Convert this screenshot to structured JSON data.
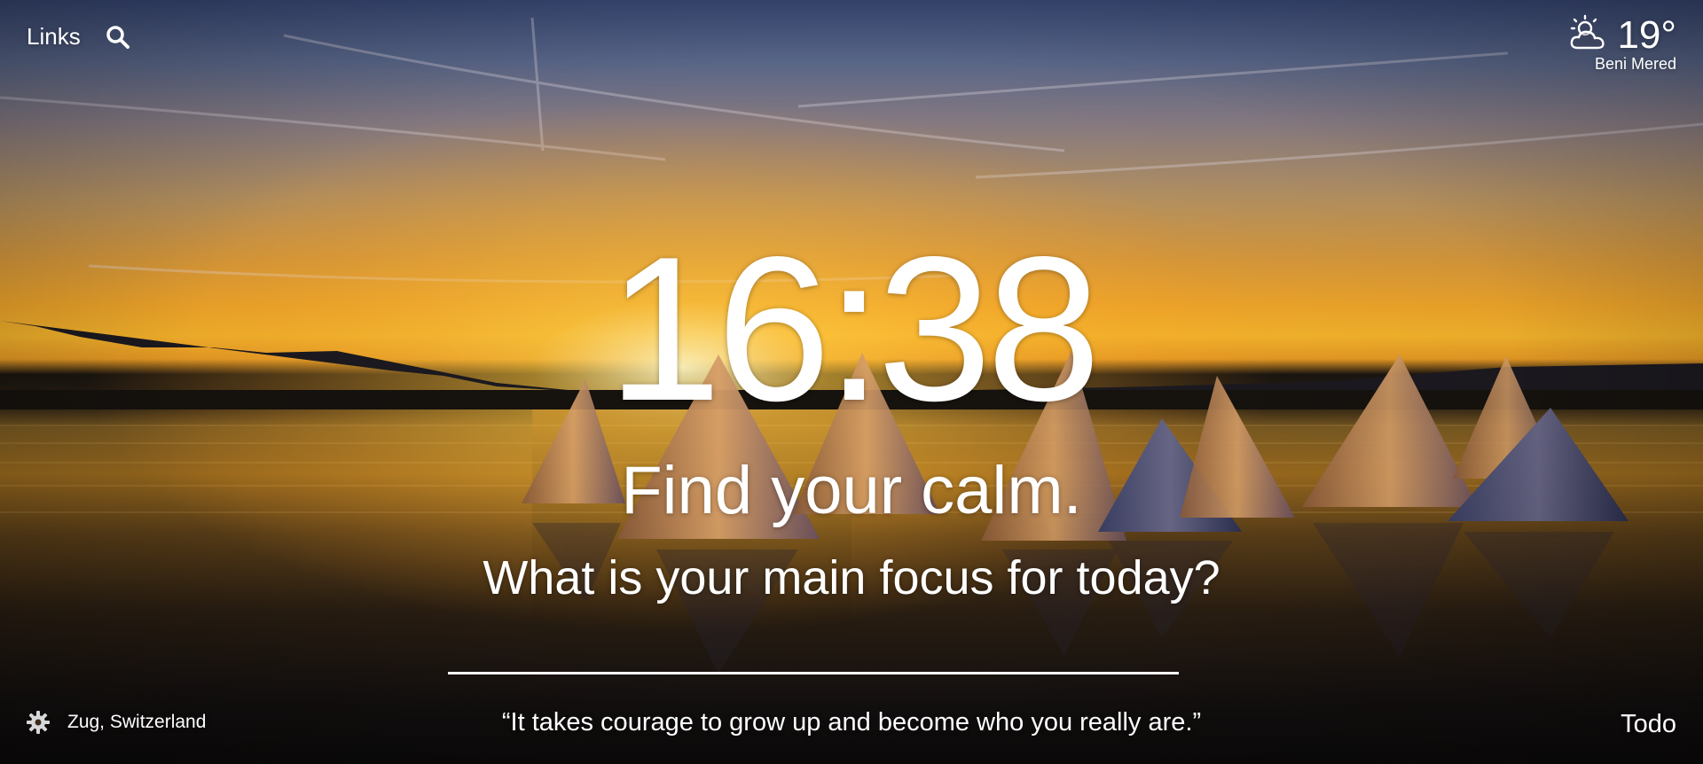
{
  "header": {
    "links_label": "Links",
    "search_icon": "search-icon"
  },
  "weather": {
    "icon": "partly-sunny-icon",
    "temperature": "19°",
    "location": "Beni Mered"
  },
  "main": {
    "time": "16:38",
    "mantra": "Find your calm.",
    "focus_question": "What is your main focus for today?",
    "focus_input_value": ""
  },
  "footer": {
    "settings_icon": "gear-icon",
    "photo_location": "Zug, Switzerland",
    "quote": "“It takes courage to grow up and become who you really are.”",
    "todo_label": "Todo"
  }
}
